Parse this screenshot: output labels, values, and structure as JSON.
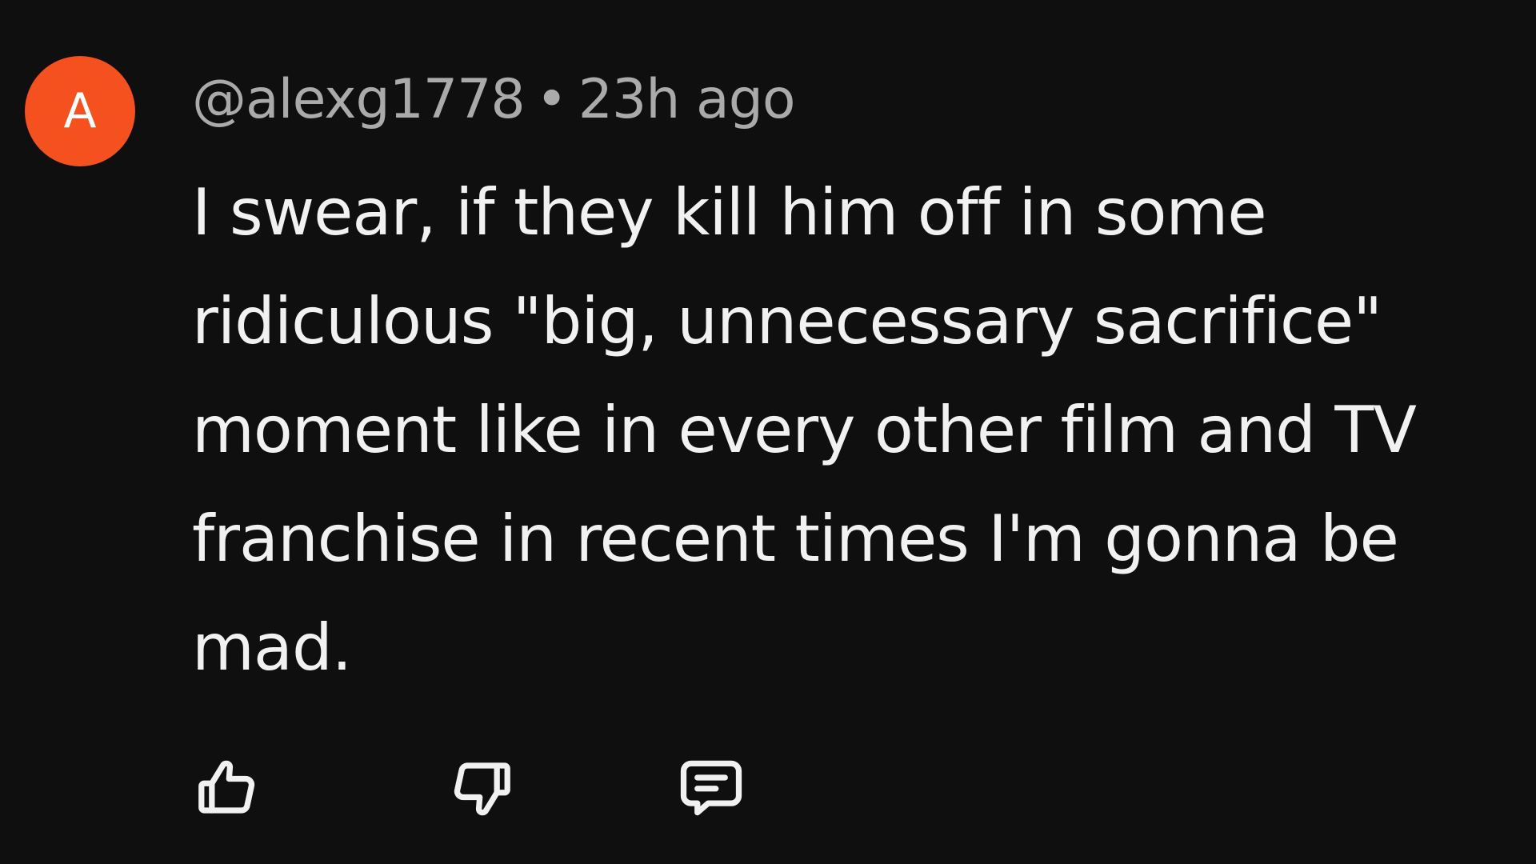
{
  "comment": {
    "avatar_letter": "A",
    "author": "@alexg1778",
    "separator": "•",
    "time": "23h ago",
    "text": "I swear, if they kill him off in some ridiculous \"big, unnecessary sacrifice\" moment like in every other film and TV franchise in recent times I'm gonna be mad."
  },
  "actions": {
    "like_icon": "thumbs-up-icon",
    "dislike_icon": "thumbs-down-icon",
    "reply_icon": "comment-icon"
  },
  "colors": {
    "background": "#0f0f0f",
    "avatar": "#f4511e",
    "meta_text": "#aaaaaa",
    "body_text": "#f1f1f1",
    "icon": "#f1f1f1"
  }
}
